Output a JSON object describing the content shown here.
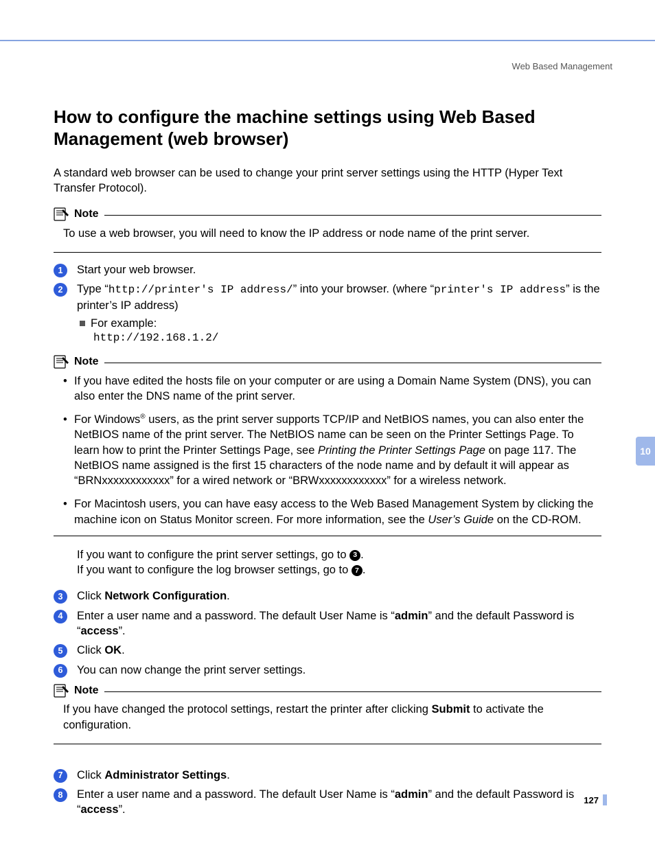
{
  "header": {
    "section": "Web Based Management"
  },
  "title": "How to configure the machine settings using Web Based Management (web browser)",
  "intro": "A standard web browser can be used to change your print server settings using the HTTP (Hyper Text Transfer Protocol).",
  "note1": {
    "label": "Note",
    "body": "To use a web browser, you will need to know the IP address or node name of the print server."
  },
  "steps": {
    "s1": "Start your web browser.",
    "s2_prefix": "Type “",
    "s2_code": "http://printer's IP address/",
    "s2_mid": "” into your browser. (where “",
    "s2_code2": "printer's IP address",
    "s2_suffix": "” is the printer’s IP address)",
    "example_label": "For example:",
    "example_url": "http://192.168.1.2/"
  },
  "note2": {
    "label": "Note",
    "b1": "If you have edited the hosts file on your computer or are using a Domain Name System (DNS), you can also enter the DNS name of the print server.",
    "b2_pre": "For Windows",
    "b2_sup": "®",
    "b2_mid": " users, as the print server supports TCP/IP and NetBIOS names, you can also enter the NetBIOS name of the print server. The NetBIOS name can be seen on the Printer Settings Page. To learn how to print the Printer Settings Page, see ",
    "b2_italic": "Printing the Printer Settings Page",
    "b2_post": " on page 117. The NetBIOS name assigned is the first 15 characters of the node name and by default it will appear as “BRNxxxxxxxxxxxx” for a wired network or “BRWxxxxxxxxxxxx” for a wireless network.",
    "b3_pre": "For Macintosh users, you can have easy access to the Web Based Management System by clicking the machine icon on Status Monitor screen. For more information, see the ",
    "b3_italic": "User’s Guide",
    "b3_post": " on the CD-ROM."
  },
  "goto": {
    "g1_pre": "If you want to configure the print server settings, go to ",
    "g1_num": "3",
    "g2_pre": "If you want to configure the log browser settings, go to ",
    "g2_num": "7"
  },
  "s3": {
    "pre": "Click ",
    "bold": "Network Configuration",
    "post": "."
  },
  "s4": {
    "pre": "Enter a user name and a password. The default User Name is “",
    "b1": "admin",
    "mid": "” and the default Password is “",
    "b2": "access",
    "post": "”."
  },
  "s5": {
    "pre": "Click ",
    "bold": "OK",
    "post": "."
  },
  "s6": "You can now change the print server settings.",
  "note3": {
    "label": "Note",
    "pre": "If you have changed the protocol settings, restart the printer after clicking ",
    "bold": "Submit",
    "post": " to activate the configuration."
  },
  "s7": {
    "pre": "Click ",
    "bold": "Administrator Settings",
    "post": "."
  },
  "s8": {
    "pre": "Enter a user name and a password. The default User Name is “",
    "b1": "admin",
    "mid": "” and the default Password is “",
    "b2": "access",
    "post": "”."
  },
  "sidebar": {
    "chapter": "10"
  },
  "page": "127"
}
